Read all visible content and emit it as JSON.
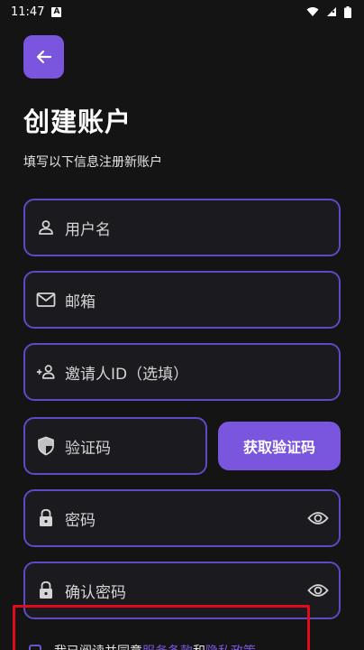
{
  "status_bar": {
    "time": "11:47",
    "notif_glyph": "A"
  },
  "header": {
    "title": "创建账户",
    "subtitle": "填写以下信息注册新账户"
  },
  "form": {
    "username_placeholder": "用户名",
    "email_placeholder": "邮箱",
    "invite_placeholder": "邀请人ID（选填）",
    "code_placeholder": "验证码",
    "get_code_label": "获取验证码",
    "password_placeholder": "密码",
    "confirm_password_placeholder": "确认密码"
  },
  "agreement": {
    "prefix": "我已阅读并同意",
    "terms_link": "服务条款",
    "and": "和",
    "privacy_link": "隐私政策"
  },
  "colors": {
    "accent": "#7a55dd",
    "border": "#5b4bc4",
    "background": "#141414",
    "highlight": "#e00c1c"
  }
}
